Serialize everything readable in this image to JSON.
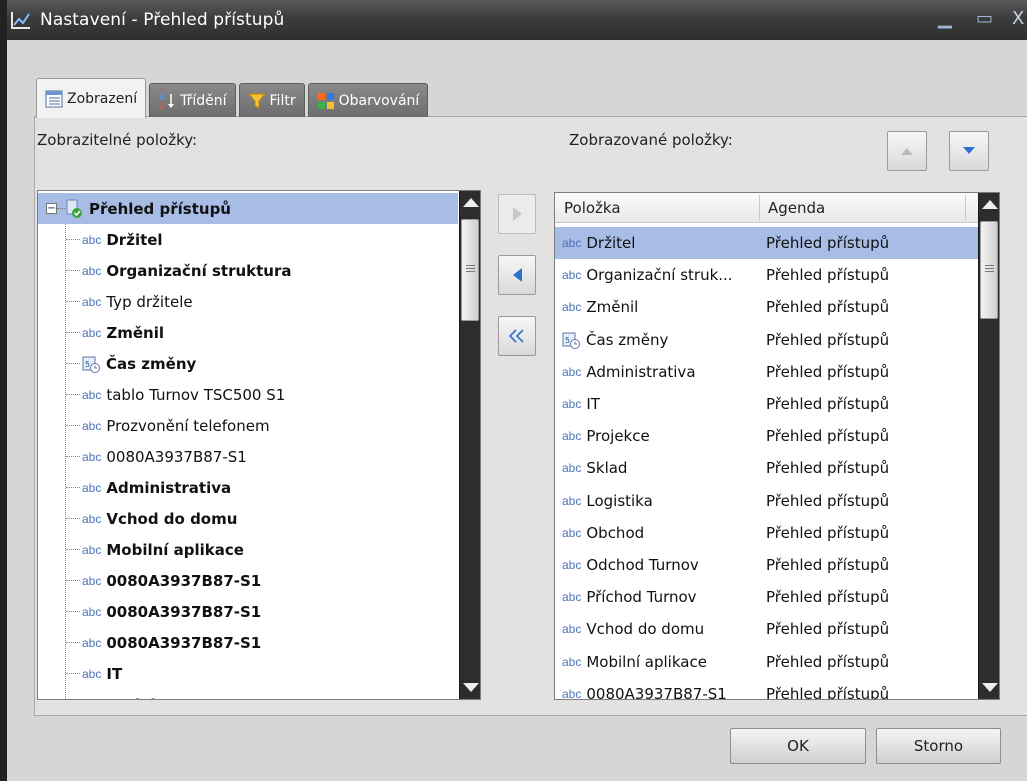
{
  "window": {
    "title": "Nastavení - Přehled přístupů",
    "minimize_glyph": "▁",
    "maximize_glyph": "▭",
    "close_glyph": "X"
  },
  "tabs": [
    {
      "label": "Zobrazení",
      "icon": "list-icon",
      "active": true
    },
    {
      "label": "Třídění",
      "icon": "sort-az-icon",
      "active": false
    },
    {
      "label": "Filtr",
      "icon": "funnel-icon",
      "active": false
    },
    {
      "label": "Obarvování",
      "icon": "color-grid-icon",
      "active": false
    }
  ],
  "left": {
    "label": "Zobrazitelné položky:",
    "root": {
      "label": "Přehled přístupů",
      "icon": "agenda-icon",
      "expander": "−"
    },
    "items": [
      {
        "prefix": "abc",
        "label": "Držitel",
        "bold": true
      },
      {
        "prefix": "abc",
        "label": "Organizační struktura",
        "bold": true
      },
      {
        "prefix": "abc",
        "label": "Typ držitele",
        "bold": false
      },
      {
        "prefix": "abc",
        "label": "Změnil",
        "bold": true
      },
      {
        "prefix": "",
        "label": "Čas změny",
        "bold": true,
        "icon": "datetime-icon"
      },
      {
        "prefix": "abc",
        "label": "tablo Turnov TSC500 S1",
        "bold": false
      },
      {
        "prefix": "abc",
        "label": "Prozvonění telefonem",
        "bold": false
      },
      {
        "prefix": "abc",
        "label": "0080A3937B87-S1",
        "bold": false
      },
      {
        "prefix": "abc",
        "label": "Administrativa",
        "bold": true
      },
      {
        "prefix": "abc",
        "label": "Vchod do domu",
        "bold": true
      },
      {
        "prefix": "abc",
        "label": "Mobilní aplikace",
        "bold": true
      },
      {
        "prefix": "abc",
        "label": "0080A3937B87-S1",
        "bold": true
      },
      {
        "prefix": "abc",
        "label": "0080A3937B87-S1",
        "bold": true
      },
      {
        "prefix": "abc",
        "label": "0080A3937B87-S1",
        "bold": true
      },
      {
        "prefix": "abc",
        "label": "IT",
        "bold": true
      },
      {
        "prefix": "abc",
        "label": "Projekce",
        "bold": true
      }
    ]
  },
  "right": {
    "label": "Zobrazované položky:",
    "columns": [
      "Položka",
      "Agenda"
    ],
    "rows": [
      {
        "prefix": "abc",
        "item": "Držitel",
        "agenda": "Přehled přístupů",
        "selected": true
      },
      {
        "prefix": "abc",
        "item": "Organizační struk...",
        "agenda": "Přehled přístupů"
      },
      {
        "prefix": "abc",
        "item": "Změnil",
        "agenda": "Přehled přístupů"
      },
      {
        "prefix": "",
        "item": "Čas změny",
        "agenda": "Přehled přístupů",
        "icon": "datetime-icon"
      },
      {
        "prefix": "abc",
        "item": "Administrativa",
        "agenda": "Přehled přístupů"
      },
      {
        "prefix": "abc",
        "item": "IT",
        "agenda": "Přehled přístupů"
      },
      {
        "prefix": "abc",
        "item": "Projekce",
        "agenda": "Přehled přístupů"
      },
      {
        "prefix": "abc",
        "item": "Sklad",
        "agenda": "Přehled přístupů"
      },
      {
        "prefix": "abc",
        "item": "Logistika",
        "agenda": "Přehled přístupů"
      },
      {
        "prefix": "abc",
        "item": "Obchod",
        "agenda": "Přehled přístupů"
      },
      {
        "prefix": "abc",
        "item": "Odchod Turnov",
        "agenda": "Přehled přístupů"
      },
      {
        "prefix": "abc",
        "item": "Příchod Turnov",
        "agenda": "Přehled přístupů"
      },
      {
        "prefix": "abc",
        "item": "Vchod do domu",
        "agenda": "Přehled přístupů"
      },
      {
        "prefix": "abc",
        "item": "Mobilní aplikace",
        "agenda": "Přehled přístupů"
      },
      {
        "prefix": "abc",
        "item": "0080A3937B87-S1",
        "agenda": "Přehled přístupů"
      }
    ]
  },
  "buttons": {
    "ok": "OK",
    "cancel": "Storno"
  },
  "colors": {
    "selection": "#a8bde6",
    "accent": "#2f6fd1"
  }
}
